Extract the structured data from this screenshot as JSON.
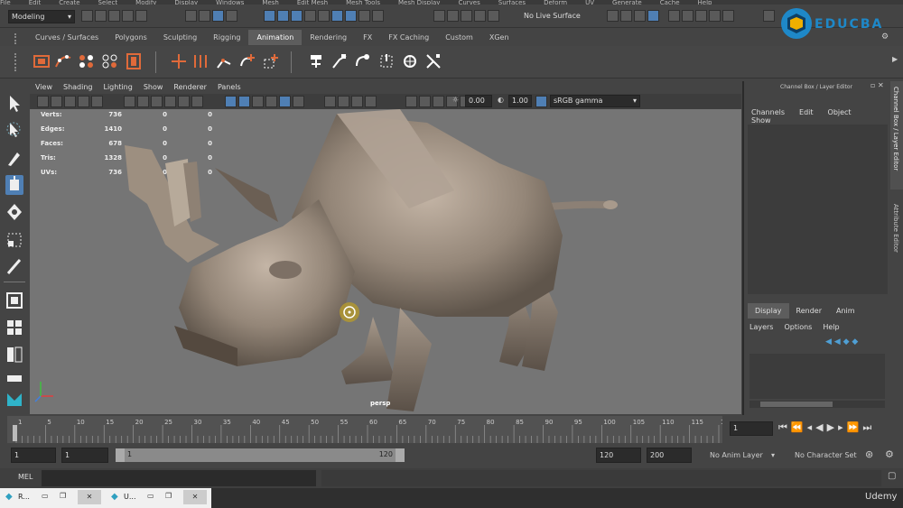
{
  "menus": [
    "File",
    "Edit",
    "Create",
    "Select",
    "Modify",
    "Display",
    "Windows",
    "Mesh",
    "Edit Mesh",
    "Mesh Tools",
    "Mesh Display",
    "Curves",
    "Surfaces",
    "Deform",
    "UV",
    "Generate",
    "Cache",
    "Help"
  ],
  "status": {
    "mode": "Modeling",
    "live_surface": "No Live Surface"
  },
  "shelf_tabs": [
    "Curves / Surfaces",
    "Polygons",
    "Sculpting",
    "Rigging",
    "Animation",
    "Rendering",
    "FX",
    "FX Caching",
    "Custom",
    "XGen"
  ],
  "active_shelf_tab": "Animation",
  "viewport_menu": [
    "View",
    "Shading",
    "Lighting",
    "Show",
    "Renderer",
    "Panels"
  ],
  "viewport_toolbar": {
    "exposure": "0.00",
    "gamma": "1.00",
    "color_space": "sRGB gamma"
  },
  "hud": [
    {
      "label": "Verts:",
      "a": "736",
      "b": "0",
      "c": "0"
    },
    {
      "label": "Edges:",
      "a": "1410",
      "b": "0",
      "c": "0"
    },
    {
      "label": "Faces:",
      "a": "678",
      "b": "0",
      "c": "0"
    },
    {
      "label": "Tris:",
      "a": "1328",
      "b": "0",
      "c": "0"
    },
    {
      "label": "UVs:",
      "a": "736",
      "b": "0",
      "c": "0"
    }
  ],
  "camera_label": "persp",
  "channel_box": {
    "title": "Channel Box / Layer Editor",
    "menu": [
      "Channels",
      "Edit",
      "Object",
      "Show"
    ]
  },
  "side_tabs": [
    "Channel Box / Layer Editor",
    "Attribute Editor"
  ],
  "layer_tabs": [
    "Display",
    "Render",
    "Anim"
  ],
  "active_layer_tab": "Display",
  "layer_menu": [
    "Layers",
    "Options",
    "Help"
  ],
  "timeline": {
    "ticks": [
      "1",
      "5",
      "10",
      "15",
      "20",
      "25",
      "30",
      "35",
      "40",
      "45",
      "50",
      "55",
      "60",
      "65",
      "70",
      "75",
      "80",
      "85",
      "90",
      "95",
      "100",
      "105",
      "110",
      "115",
      "12"
    ],
    "current_frame": "1"
  },
  "range": {
    "start": "1",
    "playback_start": "1",
    "slider_start": "1",
    "slider_end": "120",
    "playback_end": "120",
    "end": "200",
    "anim_layer": "No Anim Layer",
    "character_set": "No Character Set"
  },
  "cmd": {
    "label": "MEL"
  },
  "taskbar": [
    {
      "label": "R..."
    },
    {
      "label": "U..."
    }
  ],
  "watermark": {
    "brand": "EDUCBA",
    "udemy": "Udemy"
  },
  "colors": {
    "accent_blue": "#4f7fb4",
    "active_tab": "#5d5d5d",
    "viewport_bg": "#757575",
    "educba_blue": "#1e88c8"
  }
}
